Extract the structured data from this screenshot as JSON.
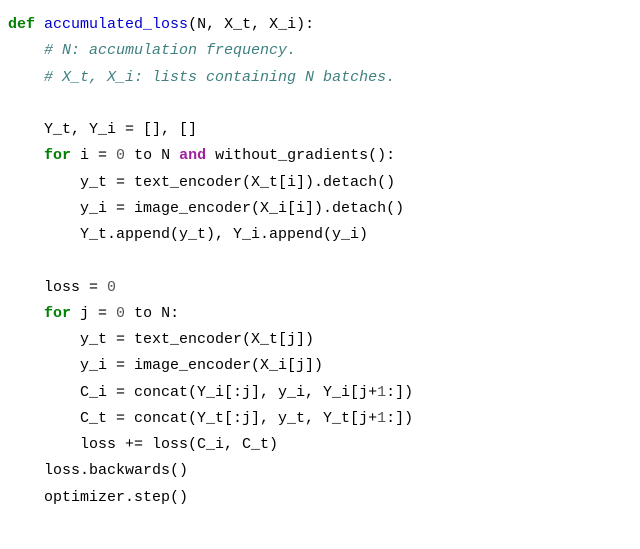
{
  "code": {
    "def": "def",
    "fn_name": "accumulated_loss",
    "sig_tail": "(N, X_t, X_i):",
    "c1": "# N: accumulation frequency.",
    "c2": "# X_t, X_i: lists containing N batches.",
    "l_init": "Y_t, Y_i = [], []",
    "for1_for": "for",
    "for1_a": " i = ",
    "for1_zero": "0",
    "for1_b": " to N ",
    "for1_and": "and",
    "for1_c": " without_gradients():",
    "l_yt1": "y_t = text_encoder(X_t[i]).detach()",
    "l_yi1": "y_i = image_encoder(X_i[i]).detach()",
    "l_app": "Y_t.append(y_t), Y_i.append(y_i)",
    "l_loss0_a": "loss = ",
    "l_loss0_z": "0",
    "for2_for": "for",
    "for2_a": " j = ",
    "for2_zero": "0",
    "for2_b": " to N:",
    "l_yt2": "y_t = text_encoder(X_t[j])",
    "l_yi2": "y_i = image_encoder(X_i[j])",
    "l_ci_a": "C_i = concat(Y_i[:j], y_i, Y_i[j+",
    "l_ci_one": "1",
    "l_ci_b": ":])",
    "l_ct_a": "C_t = concat(Y_t[:j], y_t, Y_t[j+",
    "l_ct_one": "1",
    "l_ct_b": ":])",
    "l_lossadd": "loss += loss(C_i, C_t)",
    "l_back": "loss.backwards()",
    "l_step": "optimizer.step()"
  }
}
